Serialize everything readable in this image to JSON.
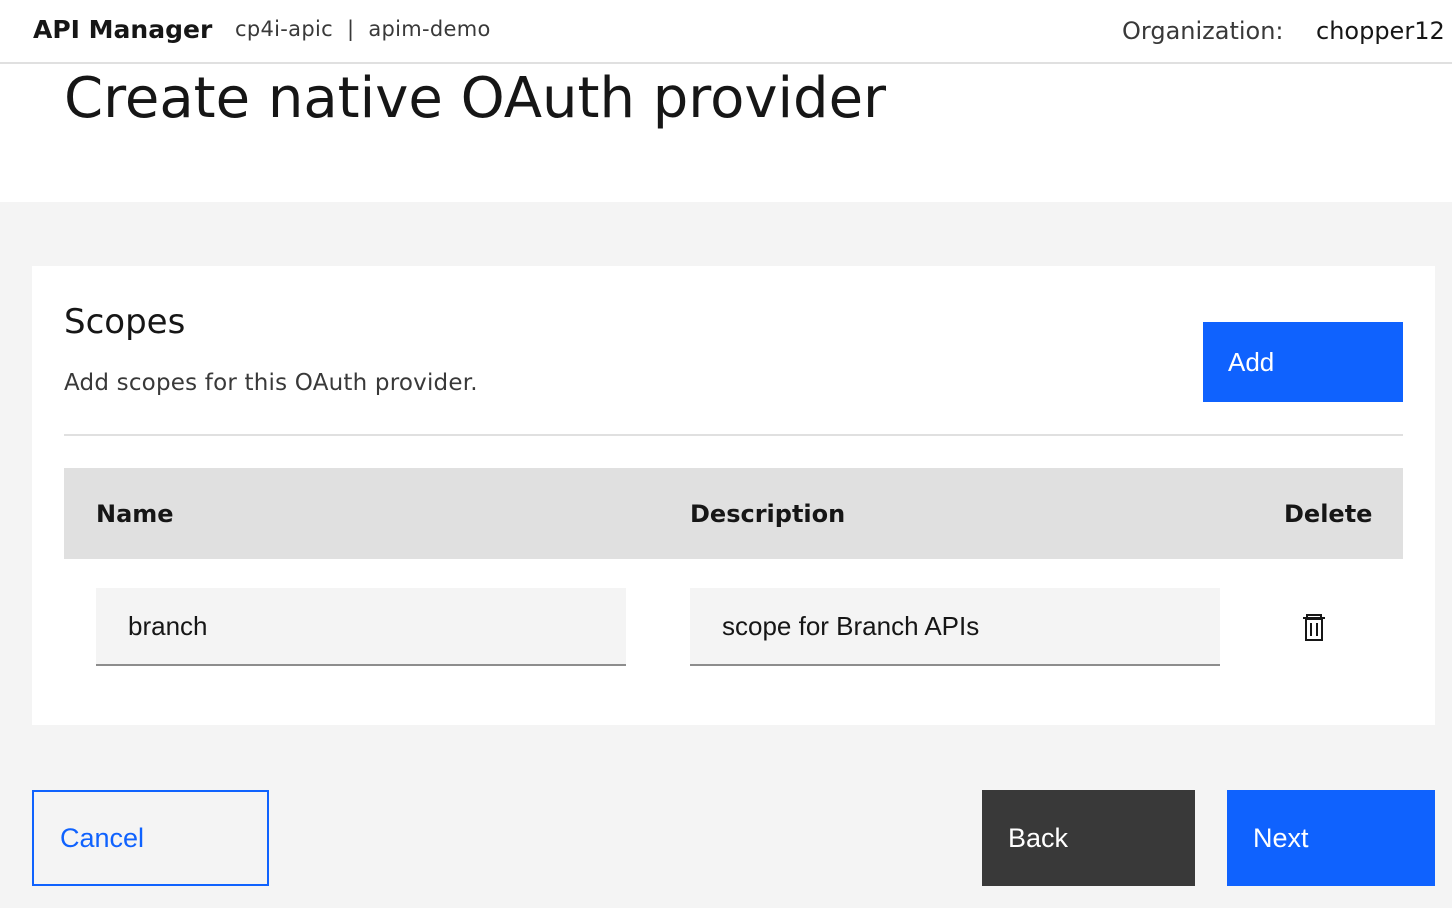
{
  "header": {
    "app_title": "API Manager",
    "breadcrumb": {
      "cluster": "cp4i-apic",
      "separator": "|",
      "namespace": "apim-demo"
    },
    "org_label": "Organization:",
    "org_value": "chopper12"
  },
  "page": {
    "title": "Create native OAuth provider"
  },
  "scopes": {
    "title": "Scopes",
    "description": "Add scopes for this OAuth provider.",
    "add_label": "Add",
    "columns": {
      "name": "Name",
      "description": "Description",
      "delete": "Delete"
    },
    "rows": [
      {
        "name": "branch",
        "description": "scope for Branch APIs",
        "delete_icon": "trash-can-icon"
      }
    ]
  },
  "footer": {
    "cancel_label": "Cancel",
    "back_label": "Back",
    "next_label": "Next"
  },
  "colors": {
    "primary": "#0f62fe",
    "secondary": "#393939",
    "background": "#f4f4f4",
    "table_header": "#e0e0e0"
  }
}
